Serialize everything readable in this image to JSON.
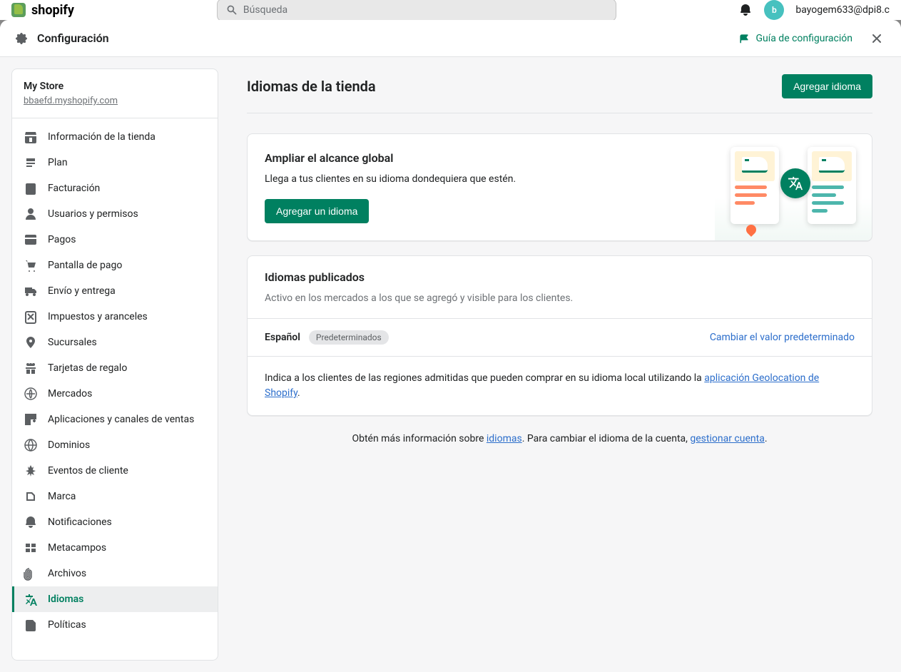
{
  "backdrop": {
    "brand": "shopify",
    "search_placeholder": "Búsqueda",
    "user_email": "bayogem633@dpi8.c",
    "avatar_initial": "b"
  },
  "modal": {
    "title": "Configuración",
    "guide_link": "Guía de configuración"
  },
  "store": {
    "name": "My Store",
    "url": "bbaefd.myshopify.com"
  },
  "nav": {
    "items": [
      {
        "label": "Información de la tienda",
        "icon": "store"
      },
      {
        "label": "Plan",
        "icon": "plan"
      },
      {
        "label": "Facturación",
        "icon": "billing"
      },
      {
        "label": "Usuarios y permisos",
        "icon": "users"
      },
      {
        "label": "Pagos",
        "icon": "payments"
      },
      {
        "label": "Pantalla de pago",
        "icon": "checkout"
      },
      {
        "label": "Envío y entrega",
        "icon": "shipping"
      },
      {
        "label": "Impuestos y aranceles",
        "icon": "taxes"
      },
      {
        "label": "Sucursales",
        "icon": "locations"
      },
      {
        "label": "Tarjetas de regalo",
        "icon": "gift"
      },
      {
        "label": "Mercados",
        "icon": "markets"
      },
      {
        "label": "Aplicaciones y canales de ventas",
        "icon": "apps"
      },
      {
        "label": "Dominios",
        "icon": "domains"
      },
      {
        "label": "Eventos de cliente",
        "icon": "events"
      },
      {
        "label": "Marca",
        "icon": "brand"
      },
      {
        "label": "Notificaciones",
        "icon": "notifications"
      },
      {
        "label": "Metacampos",
        "icon": "metafields"
      },
      {
        "label": "Archivos",
        "icon": "files"
      },
      {
        "label": "Idiomas",
        "icon": "languages",
        "active": true
      },
      {
        "label": "Políticas",
        "icon": "policies"
      }
    ]
  },
  "page": {
    "title": "Idiomas de la tienda",
    "add_language_btn": "Agregar idioma"
  },
  "reach_card": {
    "title": "Ampliar el alcance global",
    "subtitle": "Llega a tus clientes en su idioma dondequiera que estén.",
    "button": "Agregar un idioma"
  },
  "published": {
    "title": "Idiomas publicados",
    "description": "Activo en los mercados a los que se agregó y visible para los clientes.",
    "language": "Español",
    "badge": "Predeterminados",
    "change_link": "Cambiar el valor predeterminado",
    "info_prefix": "Indica a los clientes de las regiones admitidas que pueden comprar en su idioma local utilizando la ",
    "info_link": "aplicación Geolocation de Shopify",
    "info_suffix": "."
  },
  "footer": {
    "prefix": "Obtén más información sobre ",
    "link1": "idiomas",
    "middle": ". Para cambiar el idioma de la cuenta, ",
    "link2": "gestionar cuenta",
    "suffix": "."
  }
}
